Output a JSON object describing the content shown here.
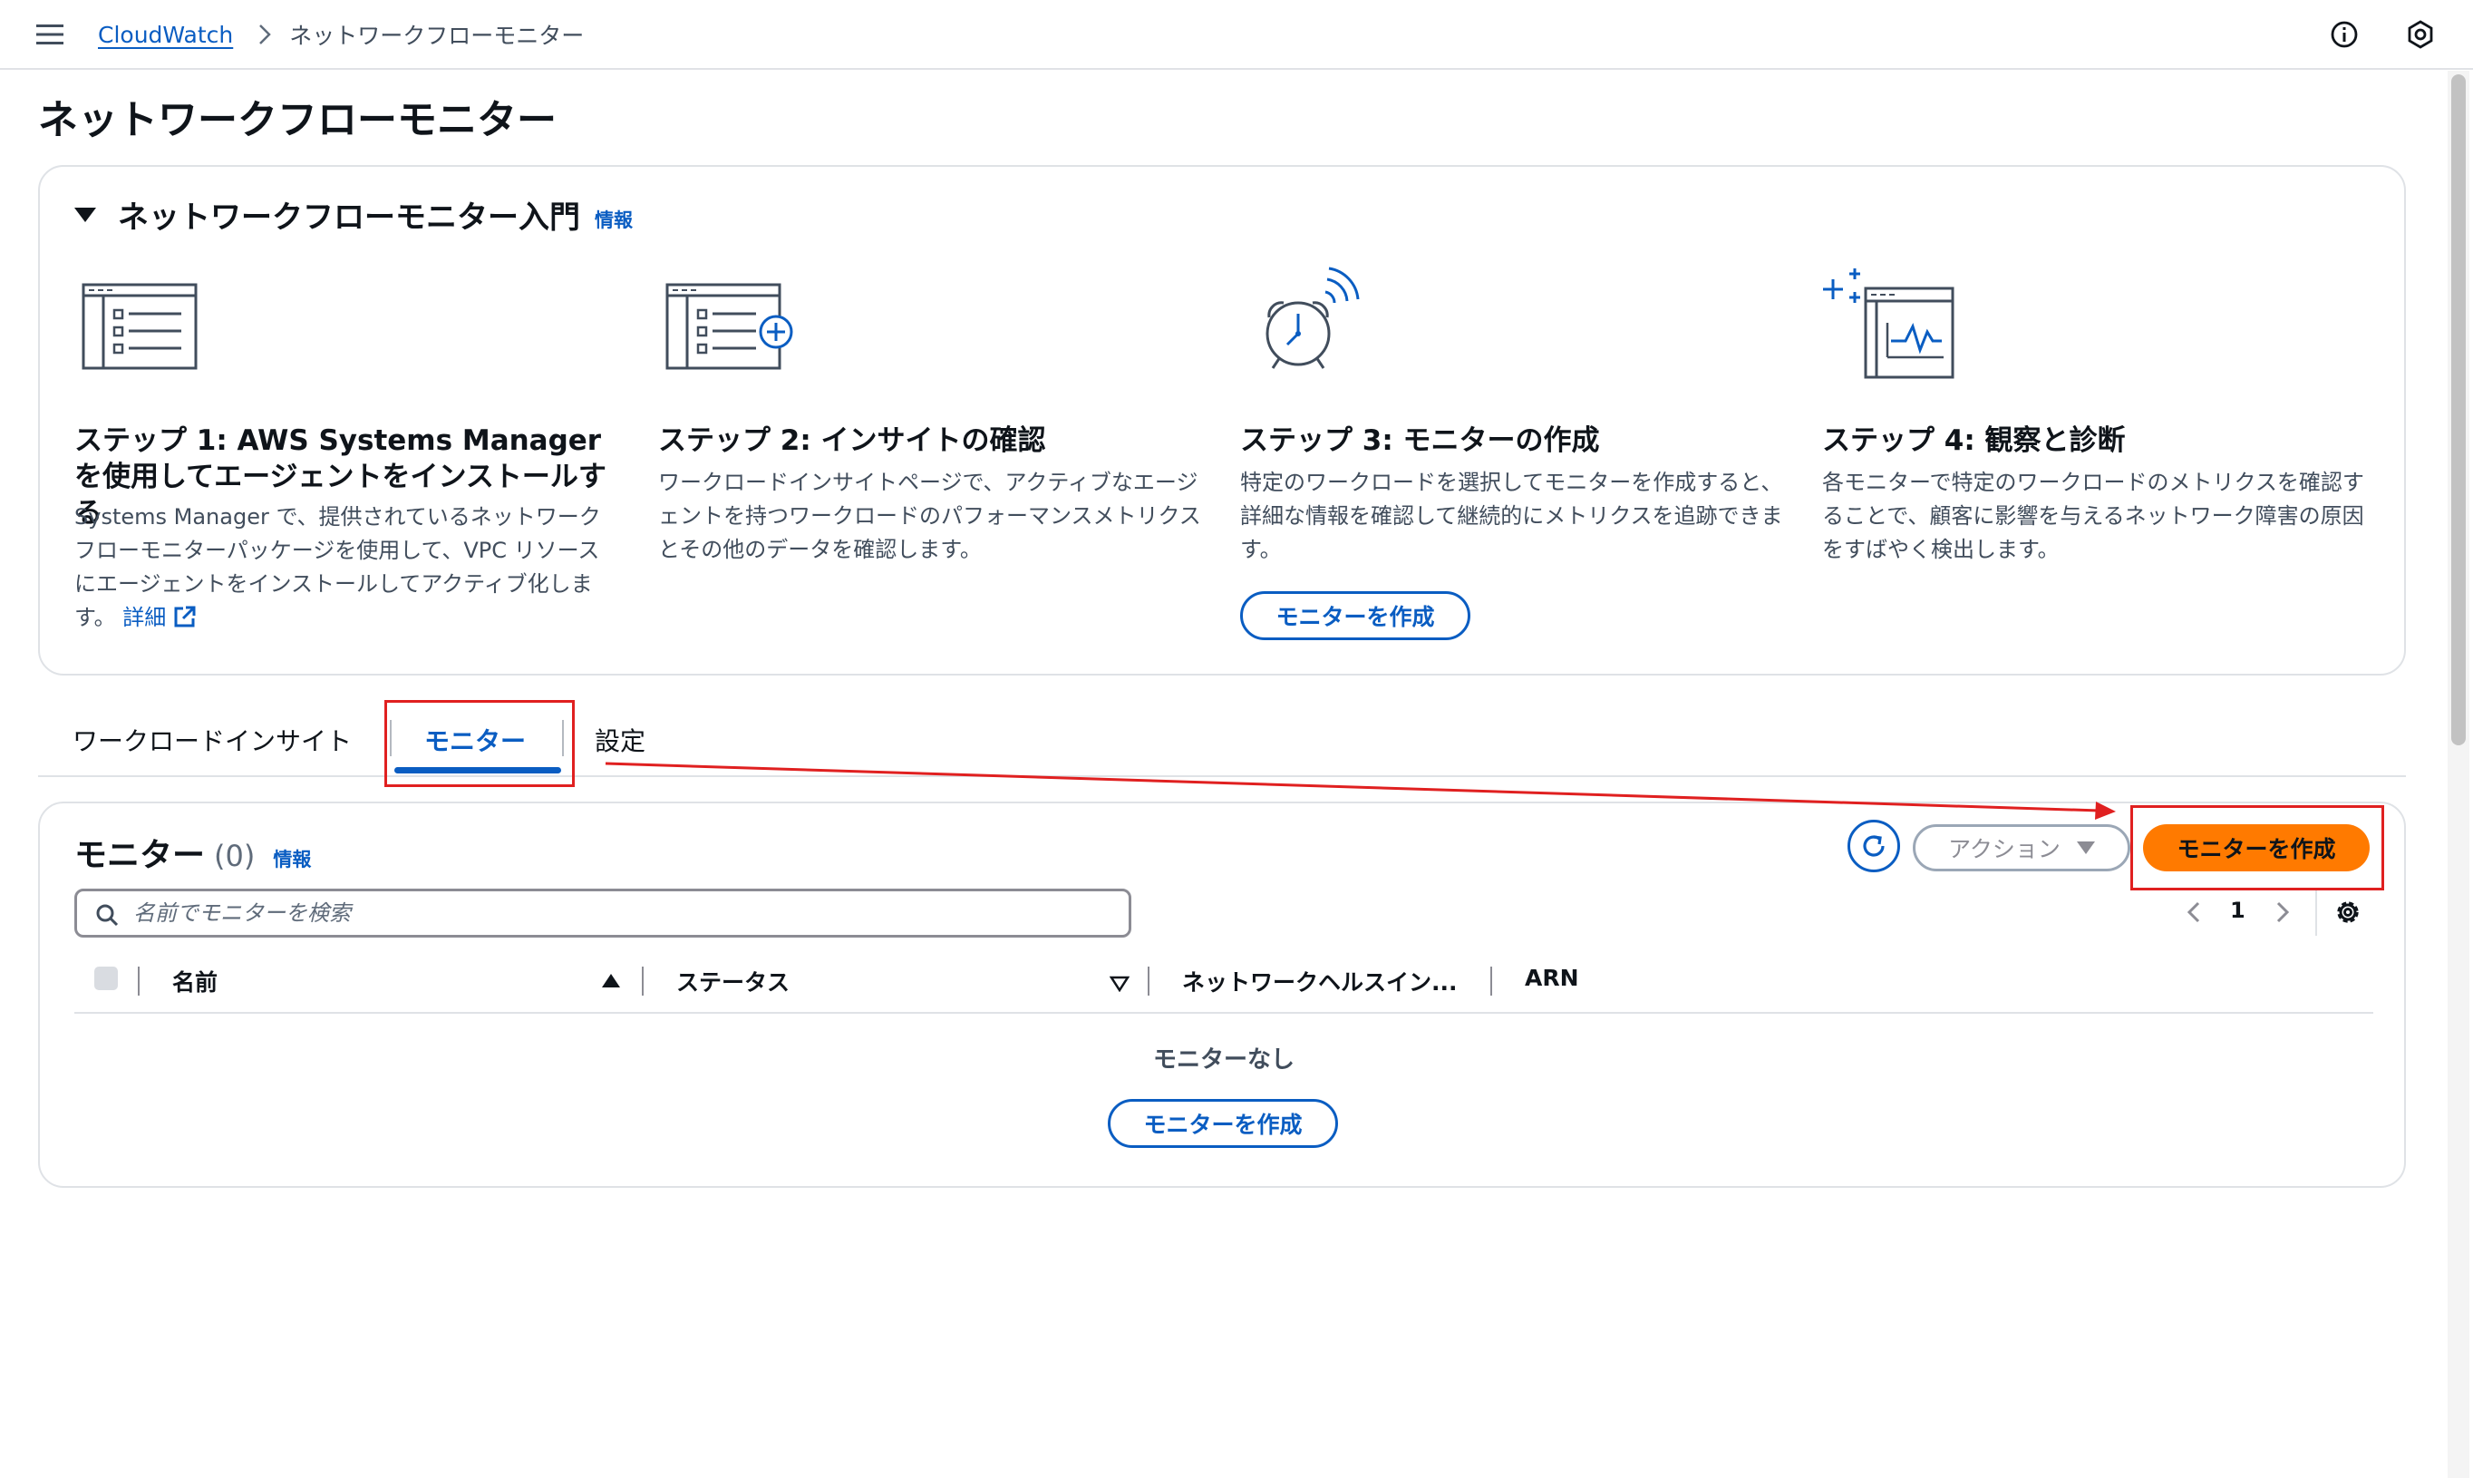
{
  "breadcrumb": {
    "root": "CloudWatch",
    "current": "ネットワークフローモニター"
  },
  "page": {
    "title": "ネットワークフローモニター"
  },
  "getting_started": {
    "title": "ネットワークフローモニター入門",
    "info": "情報",
    "steps": [
      {
        "icon": "agent-list-icon",
        "title": "ステップ 1: AWS Systems Manager を使用してエージェントをインストールする",
        "description": "Systems Manager で、提供されているネットワークフローモニターパッケージを使用して、VPC リソースにエージェントをインストールしてアクティブ化します。",
        "link": "詳細"
      },
      {
        "icon": "insights-list-add-icon",
        "title": "ステップ 2: インサイトの確認",
        "description": "ワークロードインサイトページで、アクティブなエージェントを持つワークロードのパフォーマンスメトリクスとその他のデータを確認します。"
      },
      {
        "icon": "alarm-clock-icon",
        "title": "ステップ 3: モニターの作成",
        "description": "特定のワークロードを選択してモニターを作成すると、詳細な情報を確認して継続的にメトリクスを追跡できます。",
        "button": "モニターを作成"
      },
      {
        "icon": "metrics-window-icon",
        "title": "ステップ 4: 観察と診断",
        "description": "各モニターで特定のワークロードのメトリクスを確認することで、顧客に影響を与えるネットワーク障害の原因をすばやく検出します。"
      }
    ]
  },
  "tabs": [
    {
      "label": "ワークロードインサイト",
      "active": false
    },
    {
      "label": "モニター",
      "active": true
    },
    {
      "label": "設定",
      "active": false
    }
  ],
  "monitors": {
    "title": "モニター",
    "count": "(0)",
    "info": "情報",
    "actions_label": "アクション",
    "create_label": "モニターを作成",
    "search_placeholder": "名前でモニターを検索",
    "page": "1",
    "columns": [
      "名前",
      "ステータス",
      "ネットワークヘルスイン...",
      "ARN"
    ],
    "empty_text": "モニターなし",
    "empty_button": "モニターを作成"
  },
  "colors": {
    "link_blue": "#0a5dc2",
    "primary_orange": "#ff7a00",
    "annotation_red": "#e02020"
  }
}
